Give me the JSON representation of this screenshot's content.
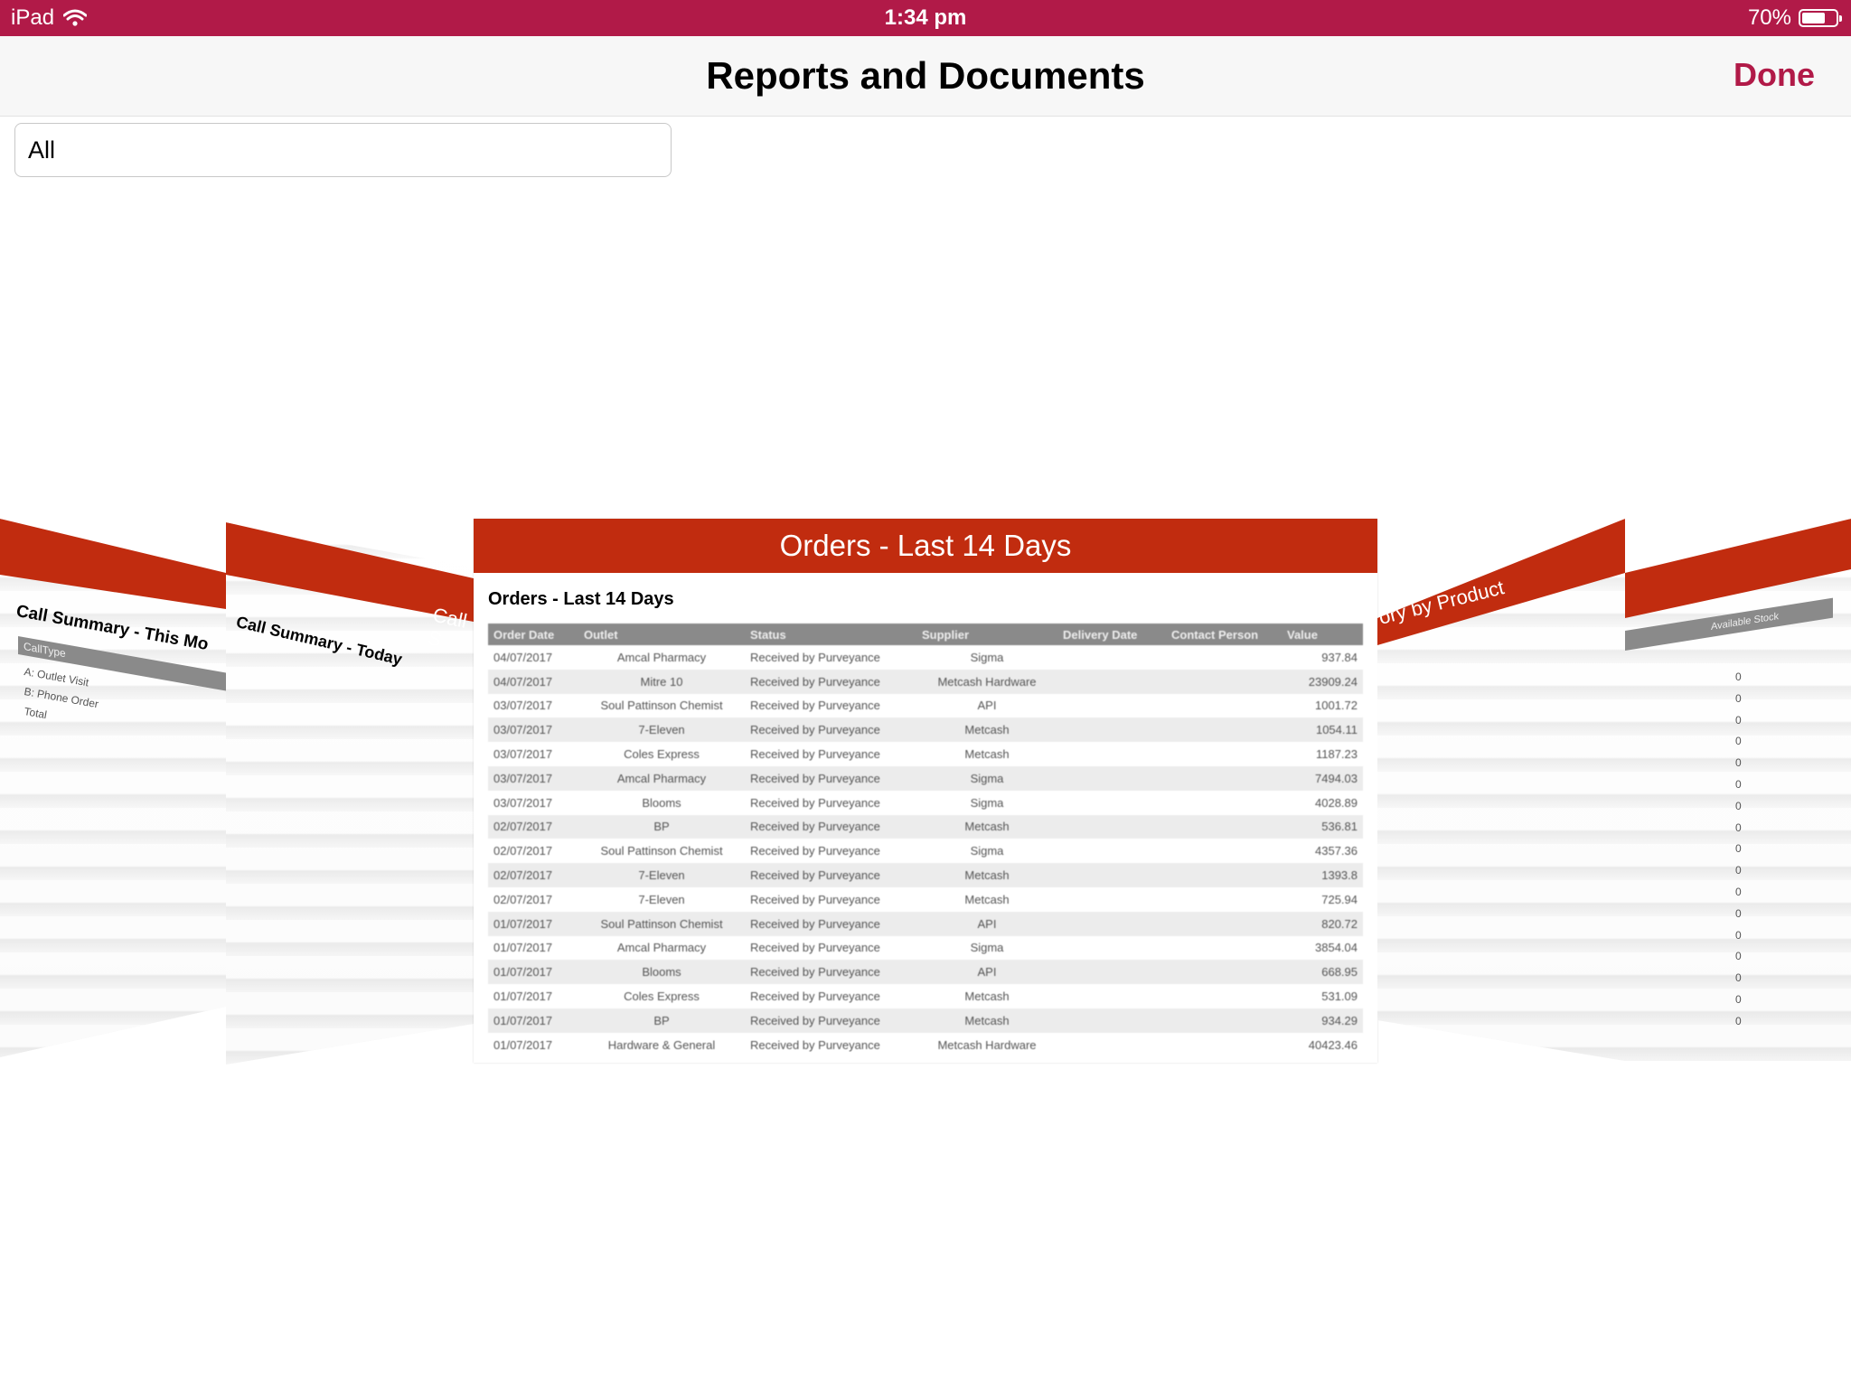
{
  "status_bar": {
    "device": "iPad",
    "time": "1:34 pm",
    "battery": "70%",
    "battery_level": 0.7
  },
  "nav": {
    "title": "Reports and Documents",
    "done_label": "Done"
  },
  "filter": {
    "value": "All"
  },
  "carousel": {
    "left_far": {
      "title": "Call Summary - This Mo",
      "table_header": "CallType",
      "rows": [
        "A: Outlet Visit",
        "B: Phone Order",
        "Total"
      ]
    },
    "left_near": {
      "header": "Call S",
      "title": "Call Summary - Today"
    },
    "main": {
      "header": "Orders - Last 14 Days",
      "title": "Orders - Last 14 Days",
      "columns": [
        "Order Date",
        "Outlet",
        "Status",
        "Supplier",
        "Delivery Date",
        "Contact Person",
        "Value"
      ],
      "rows": [
        [
          "04/07/2017",
          "Amcal Pharmacy",
          "Received by Purveyance",
          "Sigma",
          "",
          "",
          "937.84"
        ],
        [
          "04/07/2017",
          "Mitre 10",
          "Received by Purveyance",
          "Metcash Hardware",
          "",
          "",
          "23909.24"
        ],
        [
          "03/07/2017",
          "Soul Pattinson Chemist",
          "Received by Purveyance",
          "API",
          "",
          "",
          "1001.72"
        ],
        [
          "03/07/2017",
          "7-Eleven",
          "Received by Purveyance",
          "Metcash",
          "",
          "",
          "1054.11"
        ],
        [
          "03/07/2017",
          "Coles Express",
          "Received by Purveyance",
          "Metcash",
          "",
          "",
          "1187.23"
        ],
        [
          "03/07/2017",
          "Amcal Pharmacy",
          "Received by Purveyance",
          "Sigma",
          "",
          "",
          "7494.03"
        ],
        [
          "03/07/2017",
          "Blooms",
          "Received by Purveyance",
          "Sigma",
          "",
          "",
          "4028.89"
        ],
        [
          "02/07/2017",
          "BP",
          "Received by Purveyance",
          "Metcash",
          "",
          "",
          "536.81"
        ],
        [
          "02/07/2017",
          "Soul Pattinson Chemist",
          "Received by Purveyance",
          "Sigma",
          "",
          "",
          "4357.36"
        ],
        [
          "02/07/2017",
          "7-Eleven",
          "Received by Purveyance",
          "Metcash",
          "",
          "",
          "1393.8"
        ],
        [
          "02/07/2017",
          "7-Eleven",
          "Received by Purveyance",
          "Metcash",
          "",
          "",
          "725.94"
        ],
        [
          "01/07/2017",
          "Soul Pattinson Chemist",
          "Received by Purveyance",
          "API",
          "",
          "",
          "820.72"
        ],
        [
          "01/07/2017",
          "Amcal Pharmacy",
          "Received by Purveyance",
          "Sigma",
          "",
          "",
          "3854.04"
        ],
        [
          "01/07/2017",
          "Blooms",
          "Received by Purveyance",
          "API",
          "",
          "",
          "668.95"
        ],
        [
          "01/07/2017",
          "Coles Express",
          "Received by Purveyance",
          "Metcash",
          "",
          "",
          "531.09"
        ],
        [
          "01/07/2017",
          "BP",
          "Received by Purveyance",
          "Metcash",
          "",
          "",
          "934.29"
        ],
        [
          "01/07/2017",
          "Hardware & General",
          "Received by Purveyance",
          "Metcash Hardware",
          "",
          "",
          "40423.46"
        ]
      ]
    },
    "right_near": {
      "header": "ory by Product"
    },
    "right_far": {
      "table_header": "Available Stock",
      "values": [
        "0",
        "0",
        "0",
        "0",
        "0",
        "0",
        "0",
        "0",
        "0",
        "0",
        "0",
        "0",
        "0",
        "0",
        "0",
        "0",
        "0"
      ]
    }
  },
  "colors": {
    "status_bar": "#b11a48",
    "accent": "#b11a48",
    "card_header": "#c12c0f"
  },
  "icons": [
    "wifi-icon",
    "battery-icon"
  ]
}
